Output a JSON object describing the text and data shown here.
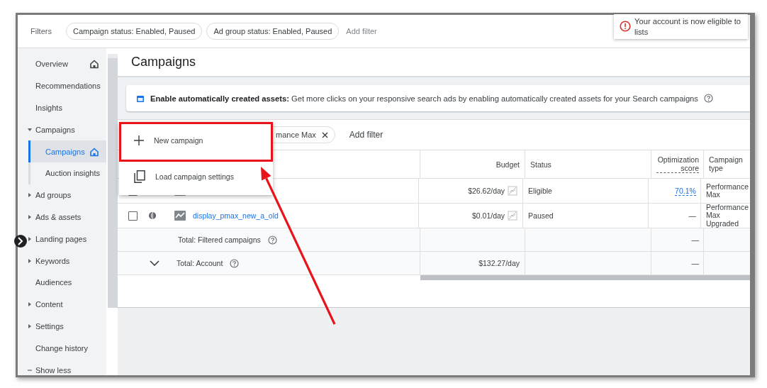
{
  "filter_bar": {
    "label": "Filters",
    "chips": [
      "Campaign status: Enabled, Paused",
      "Ad group status: Enabled, Paused"
    ],
    "add_filter": "Add filter"
  },
  "toast": {
    "message": "Your account is now eligible to lists"
  },
  "sidebar": {
    "items": [
      {
        "label": "Overview",
        "kind": "link",
        "selected": false,
        "home_icon": true
      },
      {
        "label": "Recommendations",
        "kind": "link",
        "selected": false,
        "home_icon": false
      },
      {
        "label": "Insights",
        "kind": "link",
        "selected": false,
        "home_icon": false
      },
      {
        "label": "Campaigns",
        "kind": "group",
        "expanded": true,
        "selected": false,
        "home_icon": false,
        "children": [
          {
            "label": "Campaigns",
            "selected": true,
            "home_icon": true
          },
          {
            "label": "Auction insights",
            "selected": false,
            "home_icon": false
          }
        ]
      },
      {
        "label": "Ad groups",
        "kind": "group",
        "expanded": false,
        "selected": false,
        "home_icon": false
      },
      {
        "label": "Ads & assets",
        "kind": "group",
        "expanded": false,
        "selected": false,
        "home_icon": false
      },
      {
        "label": "Landing pages",
        "kind": "group",
        "expanded": false,
        "selected": false,
        "home_icon": false
      },
      {
        "label": "Keywords",
        "kind": "group",
        "expanded": false,
        "selected": false,
        "home_icon": false
      },
      {
        "label": "Audiences",
        "kind": "link",
        "selected": false,
        "home_icon": false
      },
      {
        "label": "Content",
        "kind": "group",
        "expanded": false,
        "selected": false,
        "home_icon": false
      },
      {
        "label": "Settings",
        "kind": "group",
        "expanded": false,
        "selected": false,
        "home_icon": false
      },
      {
        "label": "Change history",
        "kind": "link",
        "selected": false,
        "home_icon": false
      },
      {
        "label": "Show less",
        "kind": "toggle",
        "selected": false,
        "home_icon": false
      }
    ]
  },
  "page_title": "Campaigns",
  "banner": {
    "text": "**Enable automatically created assets:** Get more clicks on your responsive search ads by enabling automatically created assets for your Search campaigns"
  },
  "table_filter": {
    "chip": "mance Max",
    "add_filter": "Add filter"
  },
  "table": {
    "columns": [
      {
        "label": "Budget",
        "underlined": false
      },
      {
        "label": "Status",
        "underlined": false
      },
      {
        "label": "Optimization score",
        "underlined": true
      },
      {
        "label": "Campaign type",
        "underlined": false
      }
    ],
    "rows": [
      {
        "kind": "campaign",
        "cells": [
          "$26.62/day",
          "Eligible",
          "70.1%",
          "Performance Max"
        ],
        "checked": false,
        "paused": false,
        "score_link": true
      },
      {
        "kind": "campaign",
        "name": "display_pmax_new_a_old",
        "cells": [
          "$0.01/day",
          "Paused",
          "—",
          "Performance Max Upgraded"
        ],
        "checked": false,
        "paused": true,
        "score_link": false
      },
      {
        "kind": "total",
        "name": "Total: Filtered campaigns",
        "cells": [
          null,
          null,
          "—",
          null
        ]
      },
      {
        "kind": "account_total",
        "name": "Total: Account",
        "cells": [
          "$132.27/day",
          null,
          "—",
          null
        ]
      }
    ]
  },
  "menu": {
    "items": [
      {
        "label": "New campaign",
        "kind": "add",
        "highlighted": true
      },
      {
        "label": "Load campaign settings",
        "kind": "copy",
        "highlighted": false
      }
    ]
  }
}
